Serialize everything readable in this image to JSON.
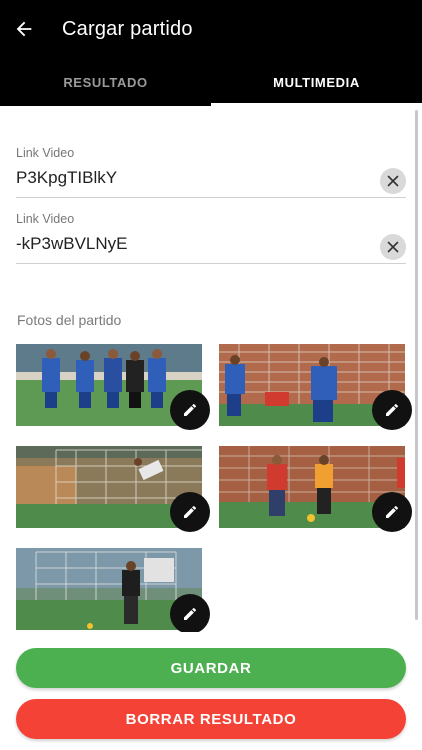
{
  "header": {
    "title": "Cargar partido",
    "back_icon": "arrow-left-icon"
  },
  "tabs": [
    {
      "label": "RESULTADO",
      "active": false
    },
    {
      "label": "MULTIMEDIA",
      "active": true
    }
  ],
  "video_links": [
    {
      "label": "Link Video",
      "value": "P3KpgTIBlkY"
    },
    {
      "label": "Link Video",
      "value": "-kP3wBVLNyE"
    }
  ],
  "photos_section": {
    "label": "Fotos del partido",
    "photos": [
      {
        "description": "team-group-photo"
      },
      {
        "description": "players-at-goal"
      },
      {
        "description": "goalkeeper-dive"
      },
      {
        "description": "players-on-field"
      },
      {
        "description": "goalkeeper-standing"
      }
    ]
  },
  "buttons": {
    "save_label": "GUARDAR",
    "delete_label": "BORRAR RESULTADO"
  },
  "colors": {
    "save": "#4caf50",
    "delete": "#f44336",
    "header": "#000000"
  }
}
